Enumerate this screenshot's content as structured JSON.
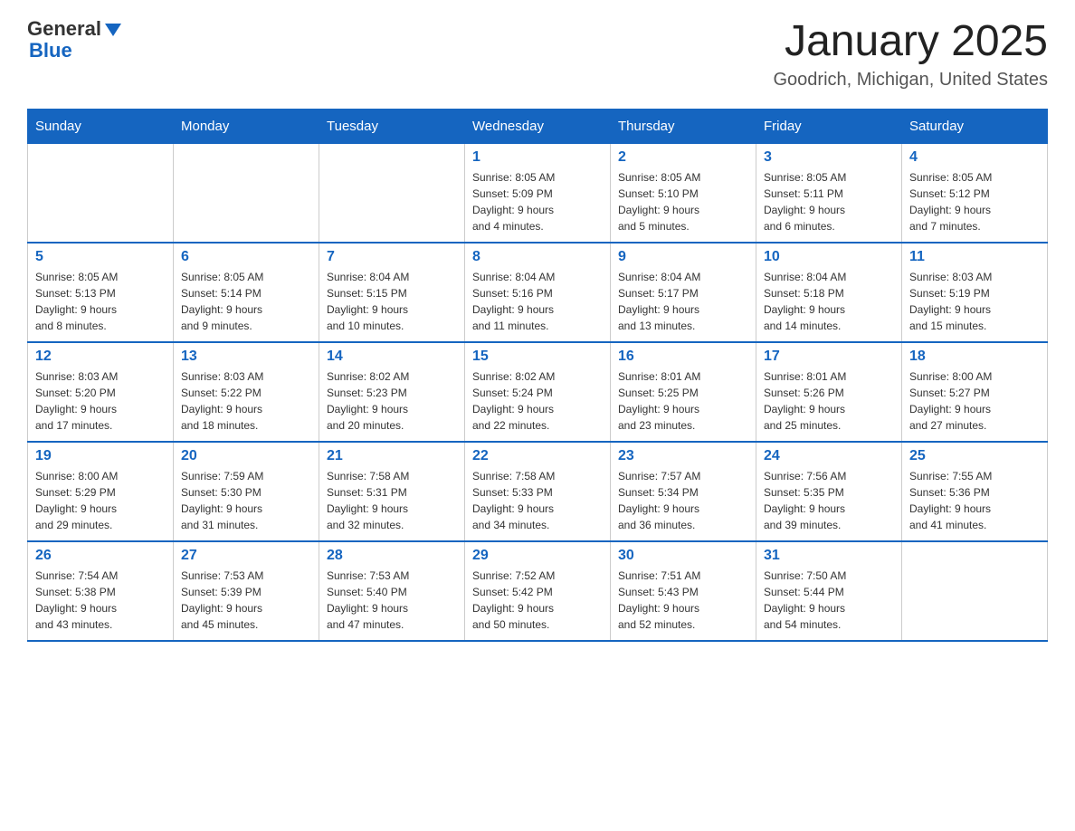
{
  "header": {
    "logo": {
      "general": "General",
      "blue": "Blue"
    },
    "title": "January 2025",
    "location": "Goodrich, Michigan, United States"
  },
  "weekdays": [
    "Sunday",
    "Monday",
    "Tuesday",
    "Wednesday",
    "Thursday",
    "Friday",
    "Saturday"
  ],
  "weeks": [
    [
      {
        "day": "",
        "info": ""
      },
      {
        "day": "",
        "info": ""
      },
      {
        "day": "",
        "info": ""
      },
      {
        "day": "1",
        "info": "Sunrise: 8:05 AM\nSunset: 5:09 PM\nDaylight: 9 hours\nand 4 minutes."
      },
      {
        "day": "2",
        "info": "Sunrise: 8:05 AM\nSunset: 5:10 PM\nDaylight: 9 hours\nand 5 minutes."
      },
      {
        "day": "3",
        "info": "Sunrise: 8:05 AM\nSunset: 5:11 PM\nDaylight: 9 hours\nand 6 minutes."
      },
      {
        "day": "4",
        "info": "Sunrise: 8:05 AM\nSunset: 5:12 PM\nDaylight: 9 hours\nand 7 minutes."
      }
    ],
    [
      {
        "day": "5",
        "info": "Sunrise: 8:05 AM\nSunset: 5:13 PM\nDaylight: 9 hours\nand 8 minutes."
      },
      {
        "day": "6",
        "info": "Sunrise: 8:05 AM\nSunset: 5:14 PM\nDaylight: 9 hours\nand 9 minutes."
      },
      {
        "day": "7",
        "info": "Sunrise: 8:04 AM\nSunset: 5:15 PM\nDaylight: 9 hours\nand 10 minutes."
      },
      {
        "day": "8",
        "info": "Sunrise: 8:04 AM\nSunset: 5:16 PM\nDaylight: 9 hours\nand 11 minutes."
      },
      {
        "day": "9",
        "info": "Sunrise: 8:04 AM\nSunset: 5:17 PM\nDaylight: 9 hours\nand 13 minutes."
      },
      {
        "day": "10",
        "info": "Sunrise: 8:04 AM\nSunset: 5:18 PM\nDaylight: 9 hours\nand 14 minutes."
      },
      {
        "day": "11",
        "info": "Sunrise: 8:03 AM\nSunset: 5:19 PM\nDaylight: 9 hours\nand 15 minutes."
      }
    ],
    [
      {
        "day": "12",
        "info": "Sunrise: 8:03 AM\nSunset: 5:20 PM\nDaylight: 9 hours\nand 17 minutes."
      },
      {
        "day": "13",
        "info": "Sunrise: 8:03 AM\nSunset: 5:22 PM\nDaylight: 9 hours\nand 18 minutes."
      },
      {
        "day": "14",
        "info": "Sunrise: 8:02 AM\nSunset: 5:23 PM\nDaylight: 9 hours\nand 20 minutes."
      },
      {
        "day": "15",
        "info": "Sunrise: 8:02 AM\nSunset: 5:24 PM\nDaylight: 9 hours\nand 22 minutes."
      },
      {
        "day": "16",
        "info": "Sunrise: 8:01 AM\nSunset: 5:25 PM\nDaylight: 9 hours\nand 23 minutes."
      },
      {
        "day": "17",
        "info": "Sunrise: 8:01 AM\nSunset: 5:26 PM\nDaylight: 9 hours\nand 25 minutes."
      },
      {
        "day": "18",
        "info": "Sunrise: 8:00 AM\nSunset: 5:27 PM\nDaylight: 9 hours\nand 27 minutes."
      }
    ],
    [
      {
        "day": "19",
        "info": "Sunrise: 8:00 AM\nSunset: 5:29 PM\nDaylight: 9 hours\nand 29 minutes."
      },
      {
        "day": "20",
        "info": "Sunrise: 7:59 AM\nSunset: 5:30 PM\nDaylight: 9 hours\nand 31 minutes."
      },
      {
        "day": "21",
        "info": "Sunrise: 7:58 AM\nSunset: 5:31 PM\nDaylight: 9 hours\nand 32 minutes."
      },
      {
        "day": "22",
        "info": "Sunrise: 7:58 AM\nSunset: 5:33 PM\nDaylight: 9 hours\nand 34 minutes."
      },
      {
        "day": "23",
        "info": "Sunrise: 7:57 AM\nSunset: 5:34 PM\nDaylight: 9 hours\nand 36 minutes."
      },
      {
        "day": "24",
        "info": "Sunrise: 7:56 AM\nSunset: 5:35 PM\nDaylight: 9 hours\nand 39 minutes."
      },
      {
        "day": "25",
        "info": "Sunrise: 7:55 AM\nSunset: 5:36 PM\nDaylight: 9 hours\nand 41 minutes."
      }
    ],
    [
      {
        "day": "26",
        "info": "Sunrise: 7:54 AM\nSunset: 5:38 PM\nDaylight: 9 hours\nand 43 minutes."
      },
      {
        "day": "27",
        "info": "Sunrise: 7:53 AM\nSunset: 5:39 PM\nDaylight: 9 hours\nand 45 minutes."
      },
      {
        "day": "28",
        "info": "Sunrise: 7:53 AM\nSunset: 5:40 PM\nDaylight: 9 hours\nand 47 minutes."
      },
      {
        "day": "29",
        "info": "Sunrise: 7:52 AM\nSunset: 5:42 PM\nDaylight: 9 hours\nand 50 minutes."
      },
      {
        "day": "30",
        "info": "Sunrise: 7:51 AM\nSunset: 5:43 PM\nDaylight: 9 hours\nand 52 minutes."
      },
      {
        "day": "31",
        "info": "Sunrise: 7:50 AM\nSunset: 5:44 PM\nDaylight: 9 hours\nand 54 minutes."
      },
      {
        "day": "",
        "info": ""
      }
    ]
  ]
}
